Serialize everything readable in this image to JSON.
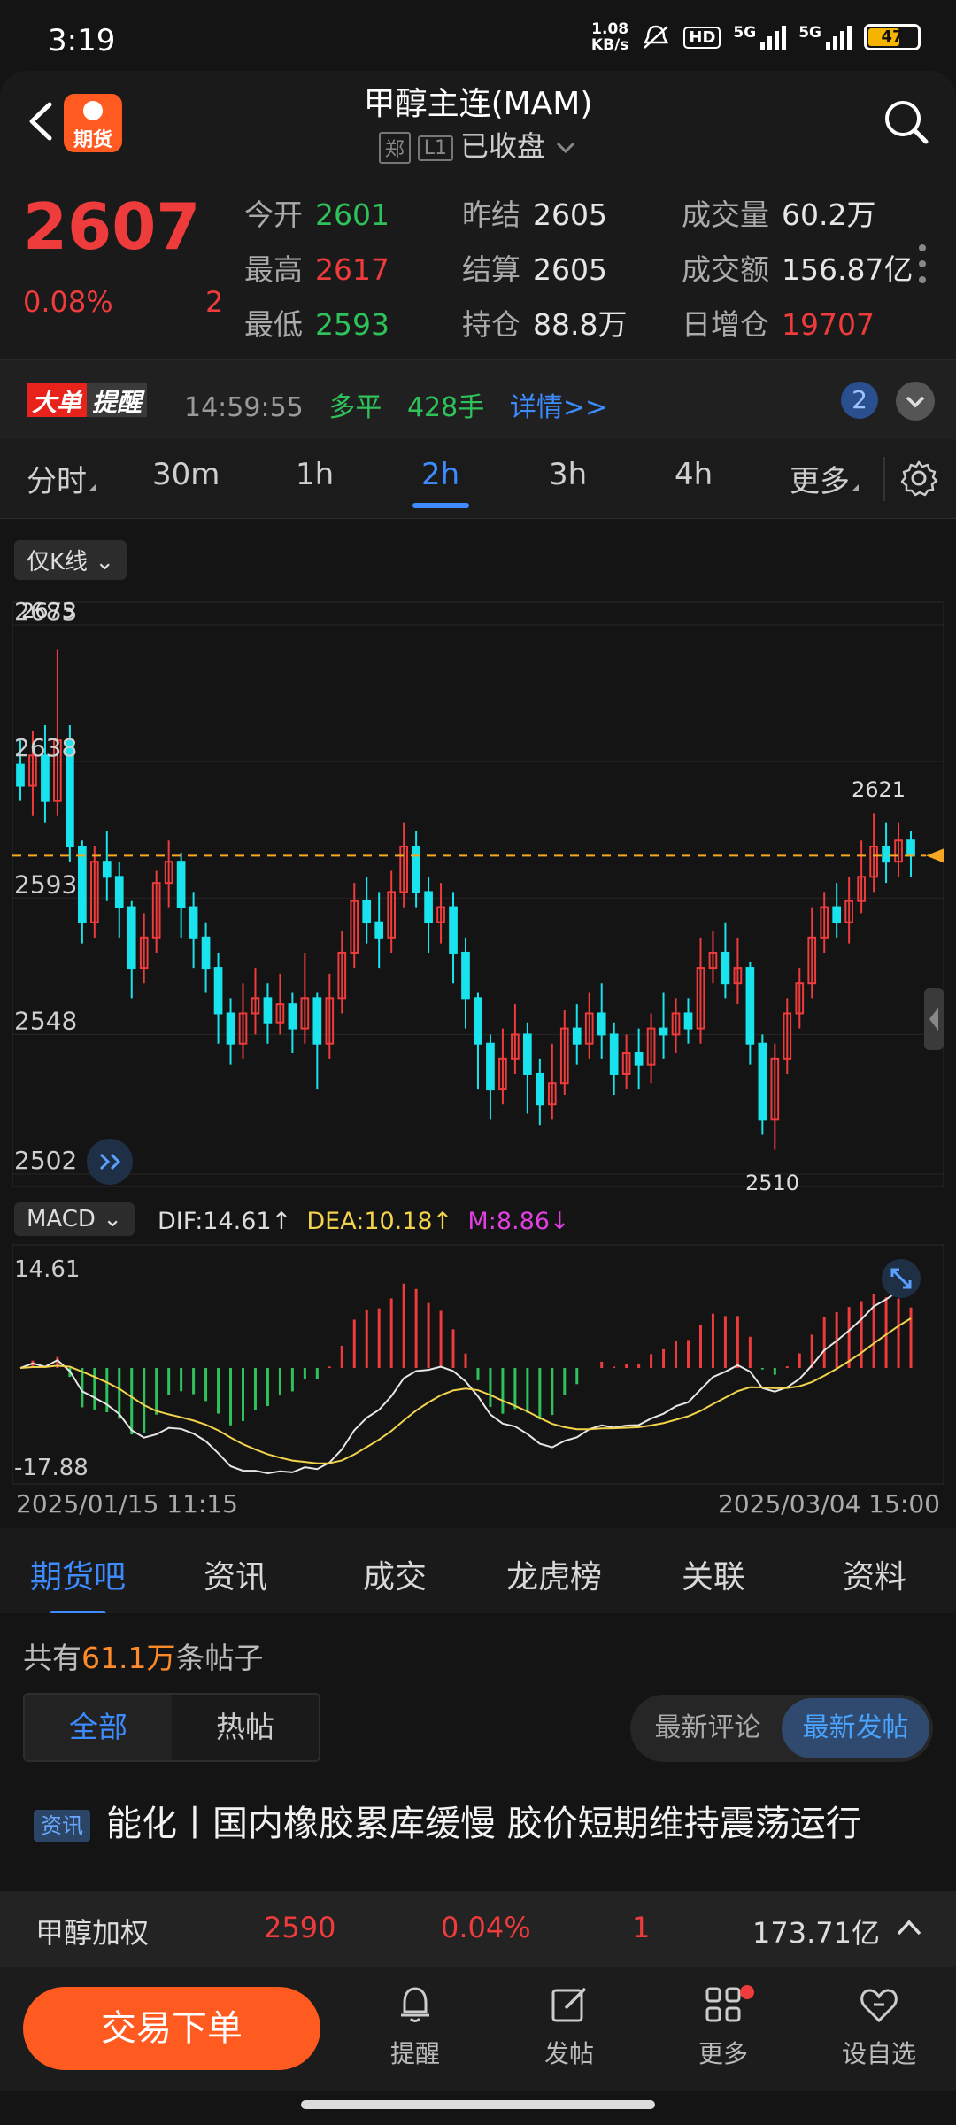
{
  "status_bar": {
    "time": "3:19",
    "net_speed": "1.08",
    "net_unit": "KB/s",
    "hd": "HD",
    "sig1": "5G",
    "sig2": "5G",
    "battery": "47"
  },
  "header": {
    "title": "甲醇主连(MAM)",
    "exchange_tag": "郑",
    "level_tag": "L1",
    "status": "已收盘",
    "logo_text": "期货"
  },
  "quote": {
    "price": "2607",
    "change_pct": "0.08%",
    "change": "2",
    "open_label": "今开",
    "open": "2601",
    "high_label": "最高",
    "high": "2617",
    "low_label": "最低",
    "low": "2593",
    "prev_settle_label": "昨结",
    "prev_settle": "2605",
    "settle_label": "结算",
    "settle": "2605",
    "oi_label": "持仓",
    "oi": "88.8万",
    "volume_label": "成交量",
    "volume": "60.2万",
    "amount_label": "成交额",
    "amount": "156.87亿",
    "oi_change_label": "日增仓",
    "oi_change": "19707"
  },
  "alert": {
    "tag_a": "大单",
    "tag_b": "提醒",
    "time": "14:59:55",
    "type": "多平",
    "qty": "428手",
    "link": "详情>>",
    "count": "2"
  },
  "period_tabs": [
    "分时",
    "30m",
    "1h",
    "2h",
    "3h",
    "4h",
    "更多"
  ],
  "period_active": "2h",
  "chart": {
    "kline_toggle": "仅K线",
    "indicator": "MACD",
    "dif": "DIF:14.61↑",
    "dea": "DEA:10.18↑",
    "m": "M:8.86↓",
    "start_time": "2025/01/15 11:15",
    "end_time": "2025/03/04 15:00"
  },
  "chart_data": {
    "type": "candlestick",
    "y_ticks": [
      "2683",
      "2638",
      "2593",
      "2548",
      "2502"
    ],
    "high_label": "2675",
    "low_label": "2510",
    "recent_high_label": "2621",
    "current_price_line": 2607,
    "ylim": [
      2502,
      2683
    ],
    "macd_ticks": [
      "14.61",
      "-17.88"
    ],
    "macd_ylim": [
      -17.88,
      14.61
    ],
    "candles": [
      [
        2637,
        2630,
        2645,
        2625
      ],
      [
        2630,
        2640,
        2648,
        2620
      ],
      [
        2640,
        2625,
        2650,
        2618
      ],
      [
        2625,
        2645,
        2675,
        2620
      ],
      [
        2645,
        2610,
        2650,
        2605
      ],
      [
        2610,
        2585,
        2612,
        2578
      ],
      [
        2585,
        2605,
        2610,
        2580
      ],
      [
        2605,
        2600,
        2615,
        2592
      ],
      [
        2600,
        2590,
        2605,
        2580
      ],
      [
        2590,
        2570,
        2592,
        2560
      ],
      [
        2570,
        2580,
        2588,
        2565
      ],
      [
        2580,
        2598,
        2602,
        2575
      ],
      [
        2598,
        2605,
        2612,
        2590
      ],
      [
        2605,
        2590,
        2608,
        2580
      ],
      [
        2590,
        2580,
        2595,
        2570
      ],
      [
        2580,
        2570,
        2585,
        2562
      ],
      [
        2570,
        2555,
        2575,
        2545
      ],
      [
        2555,
        2545,
        2560,
        2538
      ],
      [
        2545,
        2555,
        2565,
        2540
      ],
      [
        2555,
        2560,
        2570,
        2548
      ],
      [
        2560,
        2552,
        2565,
        2545
      ],
      [
        2552,
        2558,
        2568,
        2548
      ],
      [
        2558,
        2550,
        2562,
        2542
      ],
      [
        2550,
        2560,
        2575,
        2545
      ],
      [
        2560,
        2545,
        2562,
        2530
      ],
      [
        2545,
        2560,
        2568,
        2540
      ],
      [
        2560,
        2575,
        2582,
        2555
      ],
      [
        2575,
        2592,
        2598,
        2570
      ],
      [
        2592,
        2585,
        2600,
        2578
      ],
      [
        2585,
        2580,
        2595,
        2570
      ],
      [
        2580,
        2595,
        2602,
        2575
      ],
      [
        2595,
        2610,
        2618,
        2590
      ],
      [
        2610,
        2595,
        2615,
        2590
      ],
      [
        2595,
        2585,
        2600,
        2575
      ],
      [
        2585,
        2590,
        2598,
        2578
      ],
      [
        2590,
        2575,
        2595,
        2565
      ],
      [
        2575,
        2560,
        2580,
        2550
      ],
      [
        2560,
        2545,
        2562,
        2530
      ],
      [
        2545,
        2530,
        2548,
        2520
      ],
      [
        2530,
        2540,
        2550,
        2525
      ],
      [
        2540,
        2548,
        2558,
        2535
      ],
      [
        2548,
        2535,
        2552,
        2522
      ],
      [
        2535,
        2525,
        2540,
        2518
      ],
      [
        2525,
        2532,
        2545,
        2520
      ],
      [
        2532,
        2550,
        2556,
        2528
      ],
      [
        2550,
        2545,
        2558,
        2538
      ],
      [
        2545,
        2555,
        2562,
        2540
      ],
      [
        2555,
        2548,
        2565,
        2540
      ],
      [
        2548,
        2535,
        2552,
        2528
      ],
      [
        2535,
        2542,
        2548,
        2530
      ],
      [
        2542,
        2538,
        2550,
        2530
      ],
      [
        2538,
        2550,
        2555,
        2532
      ],
      [
        2550,
        2548,
        2562,
        2540
      ],
      [
        2548,
        2555,
        2560,
        2542
      ],
      [
        2555,
        2550,
        2560,
        2545
      ],
      [
        2550,
        2570,
        2580,
        2545
      ],
      [
        2570,
        2575,
        2582,
        2565
      ],
      [
        2575,
        2565,
        2585,
        2560
      ],
      [
        2565,
        2570,
        2580,
        2558
      ],
      [
        2570,
        2545,
        2572,
        2538
      ],
      [
        2545,
        2520,
        2548,
        2515
      ],
      [
        2520,
        2540,
        2545,
        2510
      ],
      [
        2540,
        2555,
        2560,
        2535
      ],
      [
        2555,
        2565,
        2570,
        2550
      ],
      [
        2565,
        2580,
        2590,
        2560
      ],
      [
        2580,
        2590,
        2595,
        2575
      ],
      [
        2590,
        2585,
        2598,
        2580
      ],
      [
        2585,
        2592,
        2600,
        2578
      ],
      [
        2592,
        2600,
        2612,
        2588
      ],
      [
        2600,
        2610,
        2621,
        2595
      ],
      [
        2610,
        2605,
        2618,
        2598
      ],
      [
        2605,
        2612,
        2618,
        2600
      ],
      [
        2612,
        2607,
        2615,
        2600
      ]
    ]
  },
  "sub_tabs": [
    "期货吧",
    "资讯",
    "成交",
    "龙虎榜",
    "关联",
    "资料"
  ],
  "posts": {
    "count_prefix": "共有",
    "count_num": "61.1万",
    "count_suffix": "条帖子",
    "filter_all": "全部",
    "filter_hot": "热帖",
    "sort_comment": "最新评论",
    "sort_post": "最新发帖",
    "news_tag": "资讯",
    "news_title": "能化丨国内橡胶累库缓慢 胶价短期维持震荡运行"
  },
  "ticker": {
    "name": "甲醇加权",
    "price": "2590",
    "pct": "0.04%",
    "chg": "1",
    "amount": "173.71亿"
  },
  "bottom_nav": {
    "order": "交易下单",
    "remind": "提醒",
    "post": "发帖",
    "more": "更多",
    "watch": "设自选"
  }
}
